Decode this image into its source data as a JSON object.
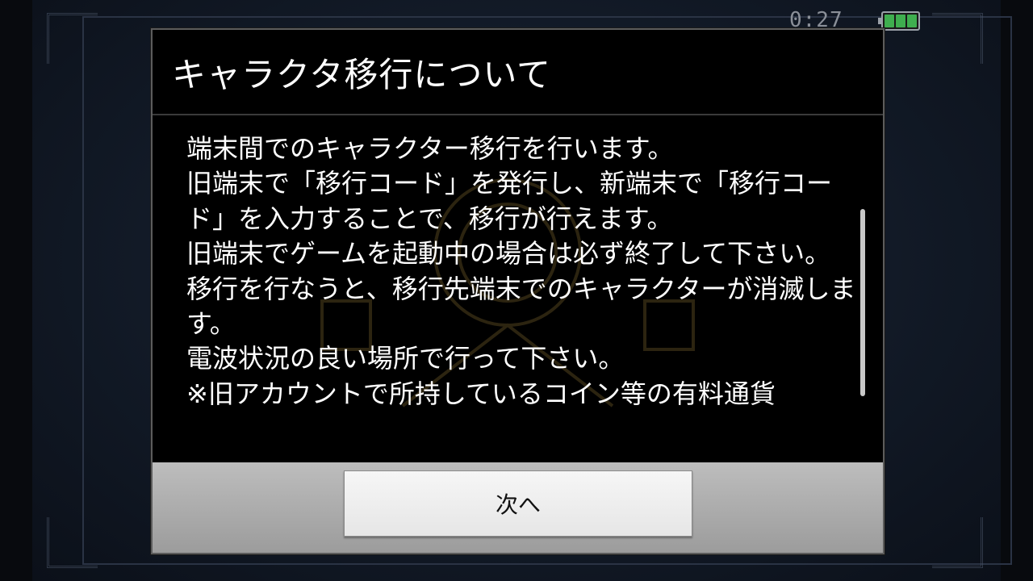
{
  "status_bar": {
    "time": "0:27",
    "battery_icon": "battery-full-icon",
    "battery_color": "#3fae4f"
  },
  "dialog": {
    "title": "キャラクタ移行について",
    "message_lines": [
      "端末間でのキャラクター移行を行います。",
      "旧端末で「移行コード」を発行し、新端末で「移行コード」を入力することで、移行が行えます。",
      "旧端末でゲームを起動中の場合は必ず終了して下さい。",
      "移行を行なうと、移行先端末でのキャラクターが消滅します。",
      "電波状況の良い場所で行って下さい。",
      "※旧アカウントで所持しているコイン等の有料通貨"
    ],
    "next_button_label": "次へ"
  },
  "colors": {
    "dialog_background": "#000000",
    "footer_background": "#b0b0b0",
    "button_background": "#efefef"
  }
}
